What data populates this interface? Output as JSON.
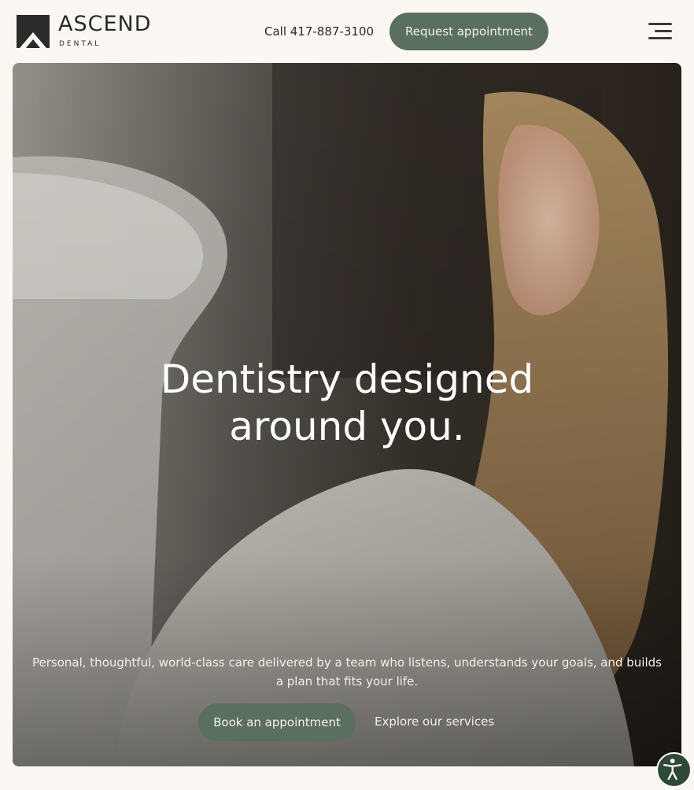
{
  "brand": {
    "name": "ASCEND",
    "sub": "DENTAL"
  },
  "header": {
    "call_label": "Call 417-887-3100",
    "request_label": "Request appointment",
    "menu_icon": "hamburger-menu-icon"
  },
  "hero": {
    "title_line1": "Dentistry designed",
    "title_line2": "around you.",
    "subtitle": "Personal, thoughtful, world-class care delivered by a team who listens, understands your goals, and builds a plan that fits your life.",
    "book_label": "Book an appointment",
    "explore_label": "Explore our services"
  },
  "accessibility": {
    "icon": "accessibility-person-icon"
  },
  "colors": {
    "accent": "#5a6f5d",
    "page_bg": "#fbf8f3",
    "text_dark": "#2a2a2a",
    "a11y_bg": "#2e4a36"
  }
}
